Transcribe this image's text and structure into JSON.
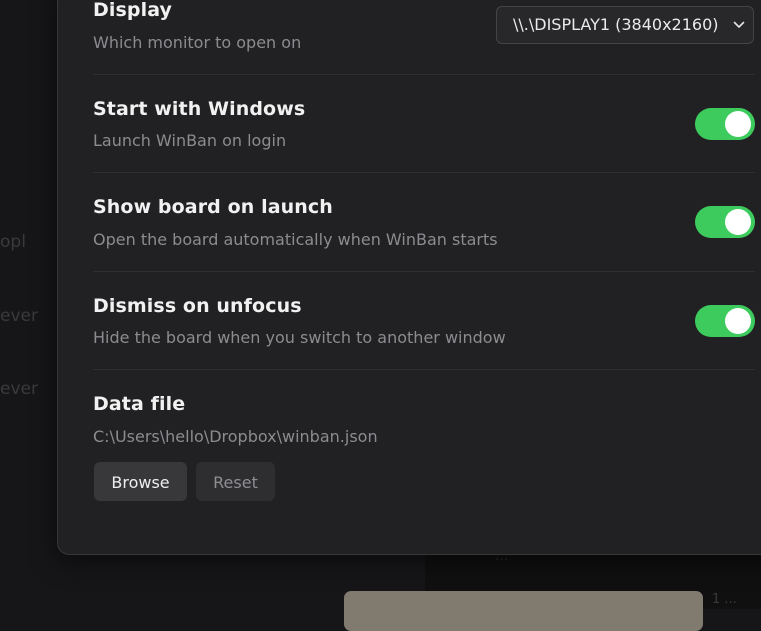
{
  "backdrop": {
    "text_1": "opl",
    "text_2": "ever",
    "text_3": "ever",
    "text_4": "...",
    "text_5": "1 ..."
  },
  "settings": {
    "display": {
      "title": "Display",
      "description": "Which monitor to open on",
      "selected_value": "\\\\.\\DISPLAY1 (3840x2160)"
    },
    "start_with_windows": {
      "title": "Start with Windows",
      "description": "Launch WinBan on login",
      "enabled": true
    },
    "show_board_on_launch": {
      "title": "Show board on launch",
      "description": "Open the board automatically when WinBan starts",
      "enabled": true
    },
    "dismiss_on_unfocus": {
      "title": "Dismiss on unfocus",
      "description": "Hide the board when you switch to another window",
      "enabled": true
    },
    "data_file": {
      "title": "Data file",
      "path": "C:\\Users\\hello\\Dropbox\\winban.json",
      "browse_label": "Browse",
      "reset_label": "Reset"
    }
  },
  "colors": {
    "toggle_on": "#3dcb5d",
    "dialog_bg": "#212123",
    "page_bg": "#161618"
  },
  "icons": {
    "select_chevron": "chevron-down-icon"
  }
}
